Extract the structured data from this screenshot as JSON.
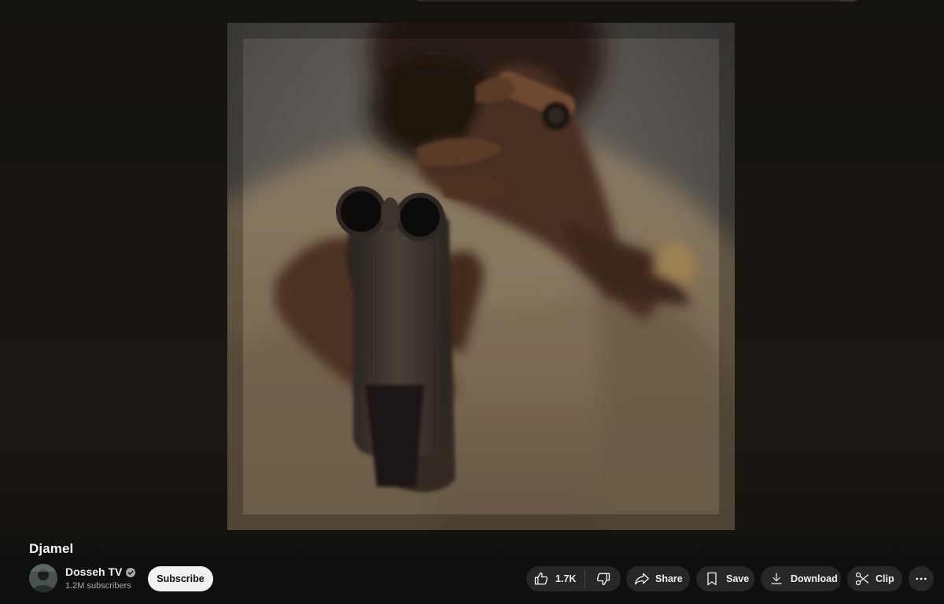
{
  "video": {
    "title": "Djamel"
  },
  "channel": {
    "name": "Dosseh TV",
    "subscribers": "1.2M subscribers",
    "verified": true,
    "avatar_icon": "avatar-image"
  },
  "buttons": {
    "subscribe": "Subscribe",
    "like_count": "1.7K",
    "share": "Share",
    "save": "Save",
    "download": "Download",
    "clip": "Clip"
  },
  "icons": {
    "like": "thumbs-up-icon",
    "dislike": "thumbs-down-icon",
    "share": "share-arrow-icon",
    "save": "bookmark-icon",
    "download": "download-icon",
    "clip": "scissors-icon",
    "more": "more-horizontal-icon",
    "verified": "verified-check-icon"
  },
  "colors": {
    "background": "#0f0f0f",
    "pill_background": "#272727",
    "subscribe_background": "#f1f1f1",
    "secondary_text": "#aaaaaa"
  }
}
